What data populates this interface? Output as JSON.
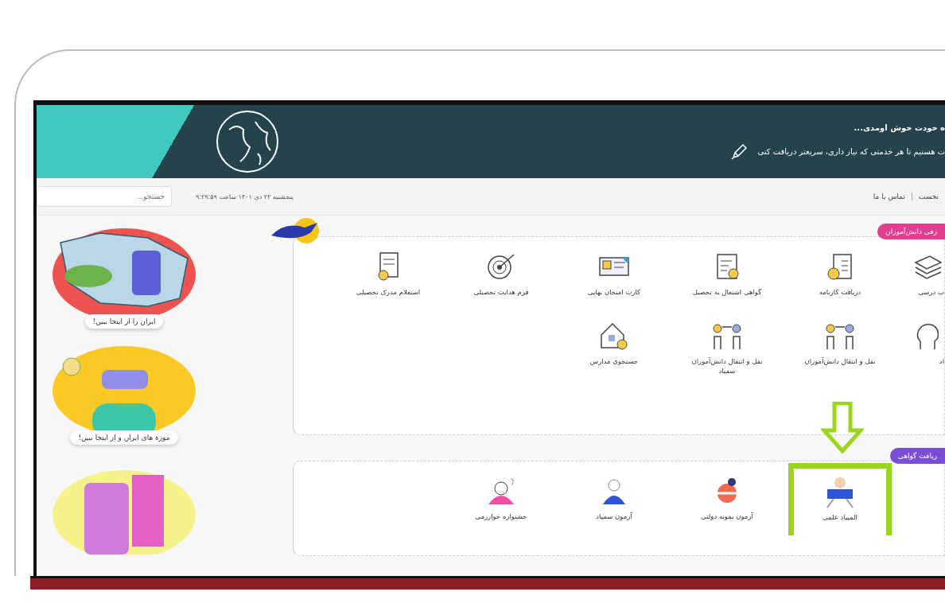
{
  "header": {
    "greeting": "ه خودت خوش اومدی...",
    "subtitle": "ت هستیم تا هر خدمتی که نیاز داری، سریعتر دریافت کنی"
  },
  "nav": {
    "links": [
      "نخست",
      "تماس با ما"
    ],
    "date": "پنجشنبه ۲۲ دی ۱۴۰۱ ساعت ۹:۲۹:۵۹",
    "search": {
      "placeholder": "جستجو..."
    }
  },
  "sidebar": {
    "cards": [
      {
        "kind": "map",
        "label": "ایران را از اینجا ببین!"
      },
      {
        "kind": "vr",
        "label": "موزه های ایران و از اینجا ببین!"
      },
      {
        "kind": "phone"
      }
    ]
  },
  "sections": [
    {
      "title": "رفی دانش‌آموزان",
      "color": "#e23d8f",
      "rows": [
        [
          {
            "label": "ب درسی",
            "highlighted": false
          },
          {
            "label": "دریافت کارنامه",
            "highlighted": false
          },
          {
            "label": "گواهی اشتغال به تحصیل",
            "highlighted": false
          },
          {
            "label": "کارت امتحان نهایی",
            "highlighted": false
          },
          {
            "label": "فرم هدایت تحصیلی",
            "highlighted": false
          },
          {
            "label": "استعلام مدرک تحصیلی",
            "highlighted": false
          }
        ],
        [
          {
            "label": "اد",
            "highlighted": false
          },
          {
            "label": "نقل و انتقال دانش‌آموزان",
            "highlighted": false
          },
          {
            "label": "نقل و انتقال دانش‌آموزان سمپاد",
            "highlighted": false
          },
          {
            "label": "جستجوی مدارس",
            "highlighted": false
          }
        ]
      ]
    },
    {
      "title": "ریافت گواهی",
      "color": "#7a4fd6",
      "rows": [
        [
          {
            "label": "المپیاد علمی",
            "highlighted": true
          },
          {
            "label": "آزمون نمونه دولتی",
            "highlighted": false
          },
          {
            "label": "آزمون سمپاد",
            "highlighted": false
          },
          {
            "label": "جشنواره خوارزمی",
            "highlighted": false
          }
        ]
      ]
    }
  ]
}
